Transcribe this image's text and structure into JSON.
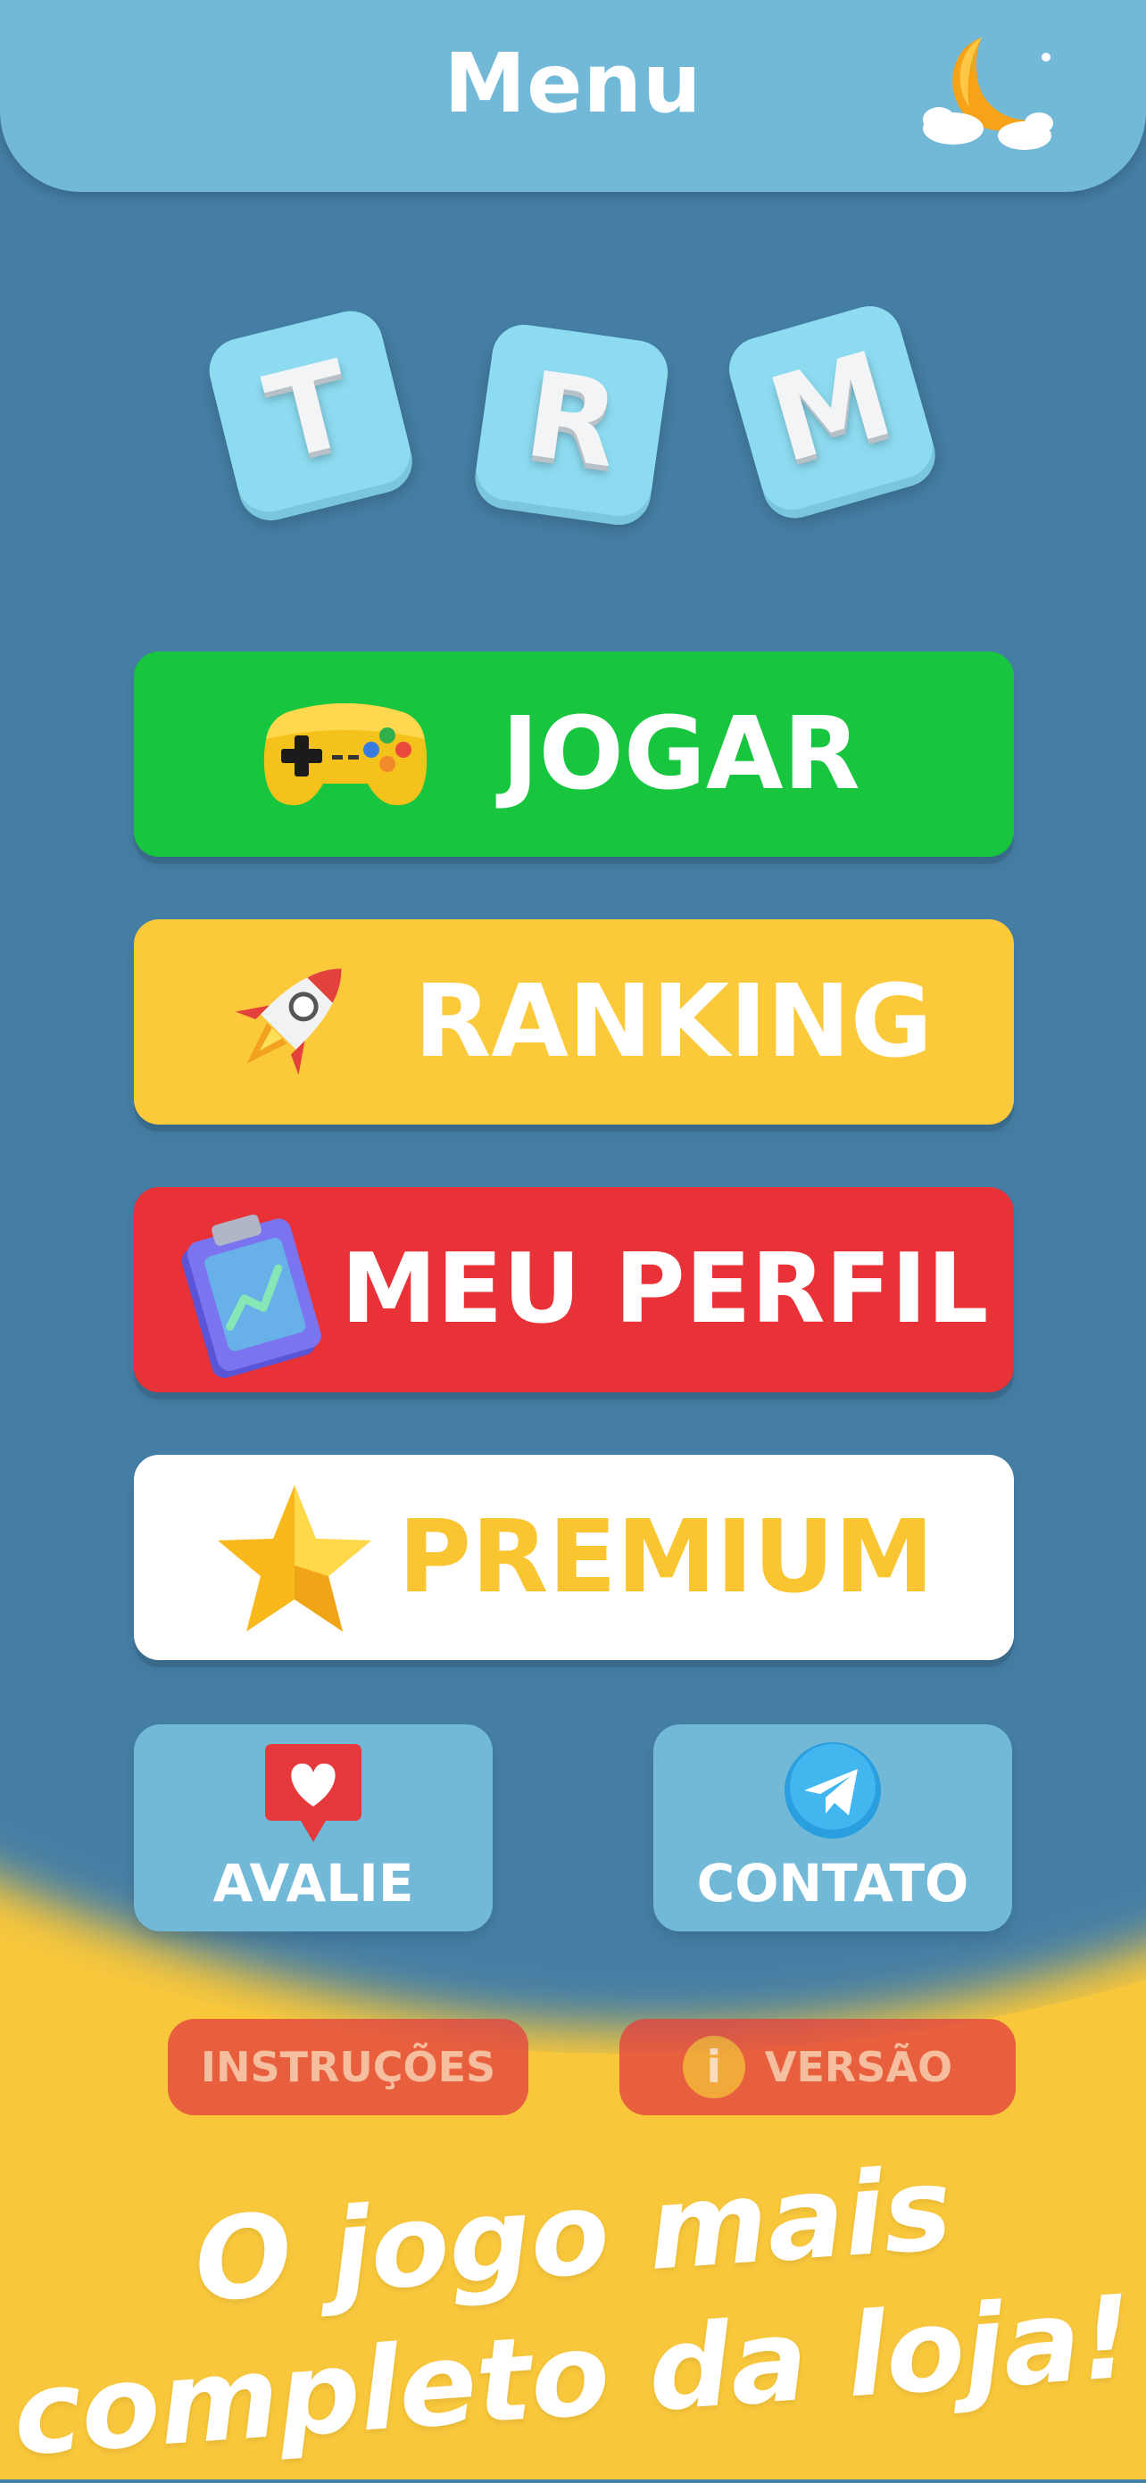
{
  "header": {
    "title": "Menu",
    "theme_icon": "moon-cloud-icon"
  },
  "logo": {
    "tiles": [
      "T",
      "R",
      "M"
    ]
  },
  "menu": {
    "play": {
      "label": "JOGAR",
      "icon": "gamepad-icon",
      "color": "#17c63e"
    },
    "ranking": {
      "label": "RANKING",
      "icon": "rocket-icon",
      "color": "#fbc93a"
    },
    "profile": {
      "label": "MEU PERFIL",
      "icon": "clipboard-chart-icon",
      "color": "#e83237"
    },
    "premium": {
      "label": "PREMIUM",
      "icon": "star-icon",
      "color": "#ffffff",
      "text_color": "#f9c531"
    }
  },
  "secondary": {
    "rate": {
      "label": "AVALIE",
      "icon": "heart-notification-icon"
    },
    "contact": {
      "label": "CONTATO",
      "icon": "telegram-icon"
    }
  },
  "tertiary": {
    "instructions": {
      "label": "INSTRUÇÕES"
    },
    "version": {
      "label": "VERSÃO",
      "icon": "info-icon"
    }
  },
  "promo": {
    "line1": "O jogo mais",
    "line2": "completo da loja!"
  },
  "colors": {
    "background": "#457fa6",
    "header": "#72b9d8",
    "wave": "#f8c73b"
  }
}
